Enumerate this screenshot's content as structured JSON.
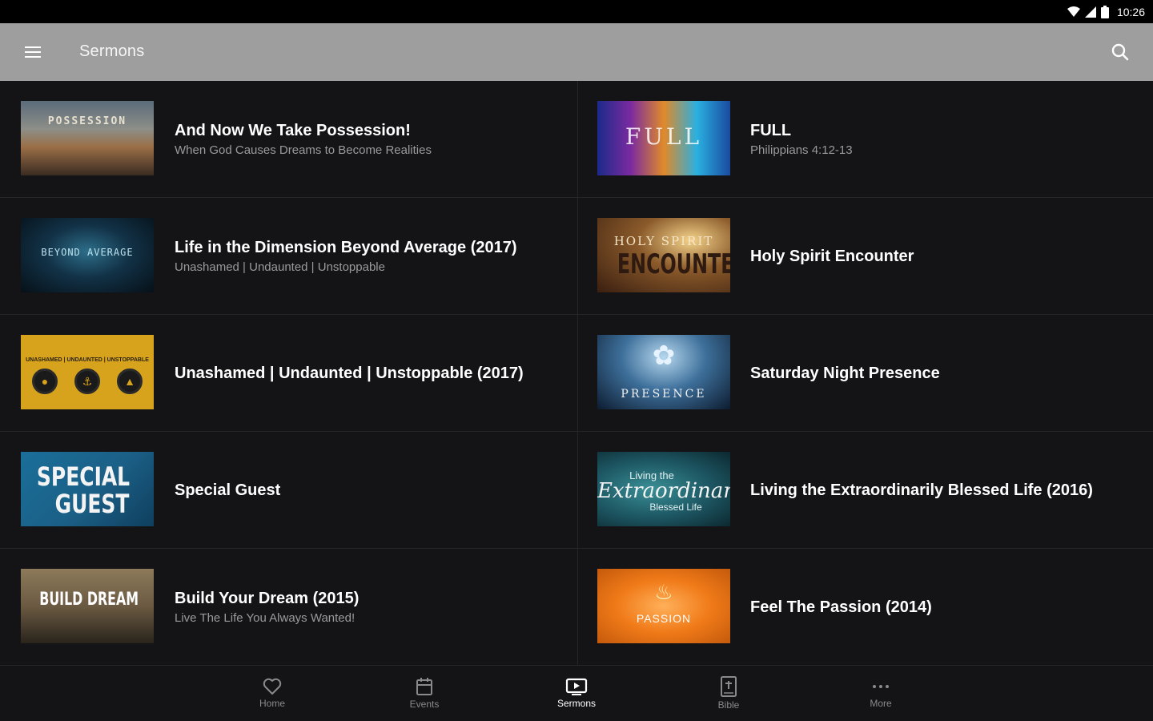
{
  "status_bar": {
    "time": "10:26"
  },
  "app_bar": {
    "title": "Sermons"
  },
  "sermons": [
    {
      "title": "And Now We Take Possession!",
      "subtitle": "When God Causes Dreams to Become Realities",
      "thumb_text": "POSSESSION"
    },
    {
      "title": "FULL",
      "subtitle": "Philippians 4:12-13",
      "thumb_text": "FULL"
    },
    {
      "title": "Life in the Dimension Beyond Average (2017)",
      "subtitle": "Unashamed | Undaunted | Unstoppable",
      "thumb_text": "BEYOND AVERAGE"
    },
    {
      "title": "Holy Spirit Encounter",
      "subtitle": "",
      "thumb_text_a": "HOLY SPIRIT",
      "thumb_text_b": "ENCOUNTER"
    },
    {
      "title": "Unashamed | Undaunted | Unstoppable (2017)",
      "subtitle": "",
      "thumb_text": "UNASHAMED | UNDAUNTED | UNSTOPPABLE"
    },
    {
      "title": "Saturday Night Presence",
      "subtitle": "",
      "thumb_text": "PRESENCE"
    },
    {
      "title": "Special Guest",
      "subtitle": "",
      "thumb_text_a": "SPECIAL",
      "thumb_text_b": "GUEST"
    },
    {
      "title": "Living the Extraordinarily Blessed Life (2016)",
      "subtitle": "",
      "thumb_text_a": "Living the",
      "thumb_text_b": "Extraordinarily",
      "thumb_text_c": "Blessed Life"
    },
    {
      "title": "Build Your Dream (2015)",
      "subtitle": "Live The Life You Always Wanted!",
      "thumb_text": "BUILD DREAM"
    },
    {
      "title": "Feel The Passion (2014)",
      "subtitle": "",
      "thumb_text": "PASSION"
    }
  ],
  "bottom_nav": [
    {
      "label": "Home",
      "icon": "heart-icon",
      "active": false
    },
    {
      "label": "Events",
      "icon": "calendar-icon",
      "active": false
    },
    {
      "label": "Sermons",
      "icon": "tv-play-icon",
      "active": true
    },
    {
      "label": "Bible",
      "icon": "bible-icon",
      "active": false
    },
    {
      "label": "More",
      "icon": "more-dots-icon",
      "active": false
    }
  ],
  "colors": {
    "app_bar": "#9e9e9e",
    "background": "#141416",
    "status_bar": "#000000",
    "nav_active": "#ffffff",
    "nav_inactive": "#8a8a8a"
  }
}
